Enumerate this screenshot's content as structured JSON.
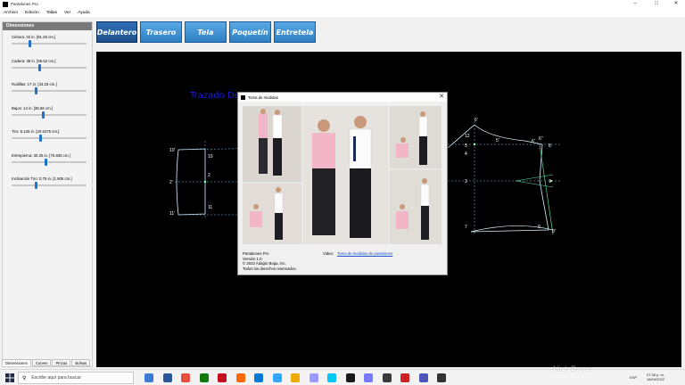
{
  "window": {
    "title": "Pantalones Pro",
    "controls": [
      "–",
      "□",
      "✕"
    ]
  },
  "menu": [
    "Archivo",
    "Edición",
    "Tallas",
    "Ver",
    "Ayuda"
  ],
  "left_panel": {
    "header": "Dimensiones",
    "sliders": [
      {
        "label": "Cintura: 32 in. [81.28 cm.]",
        "level": 0.24
      },
      {
        "label": "Cadera: 38 in. [96.52 cm.]",
        "level": 0.38
      },
      {
        "label": "Rodillas: 17 in. [43.18 cm.]",
        "level": 0.33
      },
      {
        "label": "Bajos: 14 in. [35.56 cm.]",
        "level": 0.42
      },
      {
        "label": "Tiro: 8.125 in. [20.6375 cm.]",
        "level": 0.39
      },
      {
        "label": "Entrepierna: 30.25 in. [76.835 cm.]",
        "level": 0.46
      },
      {
        "label": "Inclinación Tiro: 0.75 in. [1.905 cm.]",
        "level": 0.33
      }
    ],
    "bottom_tabs": [
      "Dimensiones",
      "Curves",
      "Pinzas",
      "Bolsas"
    ]
  },
  "top_tabs": [
    "Delantero",
    "Trasero",
    "Tela",
    "Poquetín",
    "Entretela"
  ],
  "canvas": {
    "title": "Trazado De",
    "point_labels": [
      "10'",
      "10",
      "2'",
      "2",
      "11'",
      "11",
      "6'",
      "12",
      "5",
      "4",
      "3",
      "5'",
      "6'",
      "6''",
      "8",
      "1",
      "7",
      "9",
      "9'",
      "0"
    ]
  },
  "dialog": {
    "title": "Toma de medidas",
    "close": "✕",
    "info_lines": [
      "Pantalones Pro",
      "Versión 1.0",
      "© 2022 Adagio Boga, Inc.",
      "Todos los derechos reservados."
    ],
    "video_label": "Video:",
    "video_link": "Toma de medidas de pantalones"
  },
  "taskbar": {
    "search_placeholder": "Escribe aquí para buscar",
    "lang": "ESP",
    "time": "07:38 p. m.",
    "date": "16/04/2022",
    "icon_colors": [
      "#3a7bd5",
      "#2b579a",
      "#e74c3c",
      "#107c10",
      "#c50f1f",
      "#ff6a00",
      "#0078d4",
      "#31a8ff",
      "#f2a900",
      "#9999ff",
      "#00c8ff",
      "#1a1a1a",
      "#7a7aff",
      "#3a3a3a",
      "#cc2020",
      "#4b53bc",
      "#333333"
    ]
  },
  "watermark": "Nick Boyer"
}
